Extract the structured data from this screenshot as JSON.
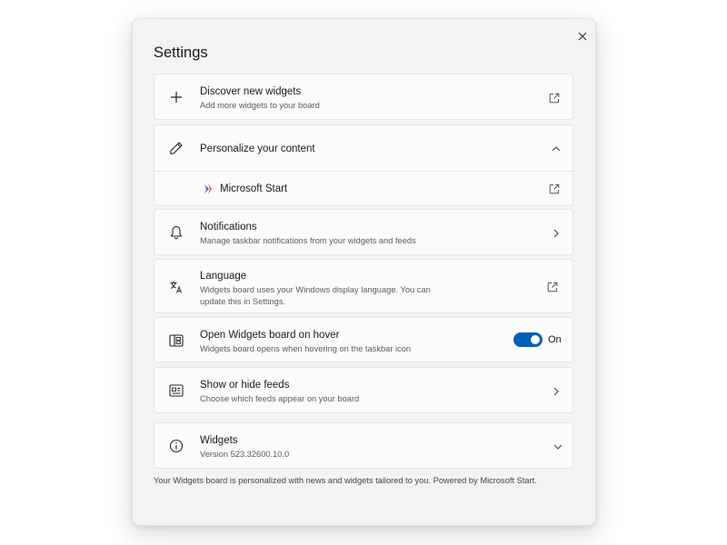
{
  "dialog": {
    "title": "Settings",
    "close_icon": "close-icon"
  },
  "rows": {
    "discover": {
      "title": "Discover new widgets",
      "description": "Add more widgets to your board",
      "icon": "plus-icon",
      "trailing_icon": "open-external-icon"
    },
    "personalize": {
      "title": "Personalize your content",
      "icon": "pencil-icon",
      "trailing_icon": "chevron-up-icon"
    },
    "microsoft_start": {
      "title": "Microsoft Start",
      "icon": "microsoft-start-icon",
      "trailing_icon": "open-external-icon"
    },
    "notifications": {
      "title": "Notifications",
      "description": "Manage taskbar notifications from your widgets and feeds",
      "icon": "bell-icon",
      "trailing_icon": "chevron-right-icon"
    },
    "language": {
      "title": "Language",
      "description_line1": "Widgets board uses your Windows display language. You can",
      "description_line2": "update this in Settings.",
      "icon": "language-icon",
      "trailing_icon": "open-external-icon"
    },
    "hover": {
      "title": "Open Widgets board on hover",
      "description": "Widgets board opens when hovering on the taskbar icon",
      "icon": "widgets-board-icon",
      "toggle_state": "On",
      "toggle_on": true,
      "accent_color": "#005fb8"
    },
    "feeds": {
      "title": "Show or hide feeds",
      "description": "Choose which feeds appear on your board",
      "icon": "feed-icon",
      "trailing_icon": "chevron-right-icon"
    },
    "about": {
      "title": "Widgets",
      "description": "Version 523.32600.10.0",
      "icon": "info-icon",
      "trailing_icon": "chevron-down-icon"
    }
  },
  "footer": {
    "text": "Your Widgets board is personalized with news and widgets tailored to you. Powered by Microsoft Start."
  }
}
